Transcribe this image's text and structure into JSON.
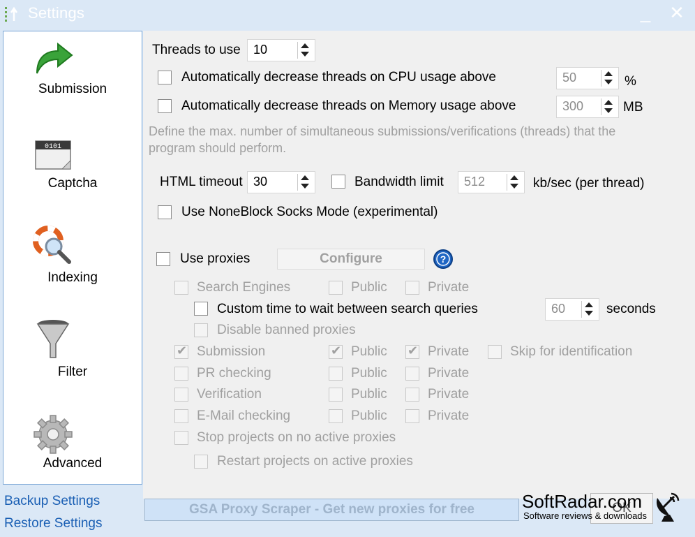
{
  "window": {
    "title": "Settings",
    "minimize": "_",
    "close": "✕"
  },
  "sidebar": {
    "items": [
      {
        "label": "Submission"
      },
      {
        "label": "Captcha"
      },
      {
        "label": "Indexing"
      },
      {
        "label": "Filter"
      },
      {
        "label": "Advanced"
      }
    ],
    "captcha_icon_text": "0101"
  },
  "threads": {
    "label": "Threads to use",
    "value": "10",
    "cpu": {
      "label": "Automatically decrease threads on CPU usage above",
      "value": "50",
      "unit": "%",
      "checked": false
    },
    "memory": {
      "label": "Automatically decrease threads on Memory usage above",
      "value": "300",
      "unit": "MB",
      "checked": false
    },
    "description_line1": "Define the max. number of simultaneous submissions/verifications (threads) that the",
    "description_line2": "program should perform."
  },
  "timeout": {
    "label": "HTML timeout",
    "value": "30",
    "bandwidth_label": "Bandwidth limit",
    "bandwidth_value": "512",
    "bandwidth_unit": "kb/sec (per thread)",
    "bandwidth_checked": false
  },
  "noneblock": {
    "label": "Use NoneBlock Socks Mode (experimental)",
    "checked": false
  },
  "proxies": {
    "label": "Use proxies",
    "checked": false,
    "configure_label": "Configure",
    "help_icon": "question-icon",
    "search_engines": {
      "label": "Search Engines",
      "public": "Public",
      "private": "Private"
    },
    "custom_wait": {
      "label": "Custom time to wait between search queries",
      "value": "60",
      "unit": "seconds",
      "checked": false
    },
    "disable_banned": {
      "label": "Disable banned proxies"
    },
    "submission": {
      "label": "Submission",
      "public": "Public",
      "private": "Private",
      "skip": "Skip for identification",
      "checked": true,
      "public_checked": true,
      "private_checked": true
    },
    "pr_checking": {
      "label": "PR checking",
      "public": "Public",
      "private": "Private"
    },
    "verification": {
      "label": "Verification",
      "public": "Public",
      "private": "Private"
    },
    "email_checking": {
      "label": "E-Mail checking",
      "public": "Public",
      "private": "Private"
    },
    "stop_projects": {
      "label": "Stop projects on no active proxies"
    },
    "restart_projects": {
      "label": "Restart projects on active proxies"
    }
  },
  "footer": {
    "backup": "Backup Settings",
    "restore": "Restore Settings",
    "proxy_scraper": "GSA Proxy Scraper - Get new proxies for free",
    "ok": "OK"
  },
  "watermark": {
    "title": "SoftRadar.com",
    "subtitle": "Software reviews & downloads"
  },
  "colors": {
    "accent": "#1a5fb4",
    "titlebar": "#dbe8f6",
    "panel": "#f0f0f0",
    "disabled_text": "#a0a0a0"
  }
}
